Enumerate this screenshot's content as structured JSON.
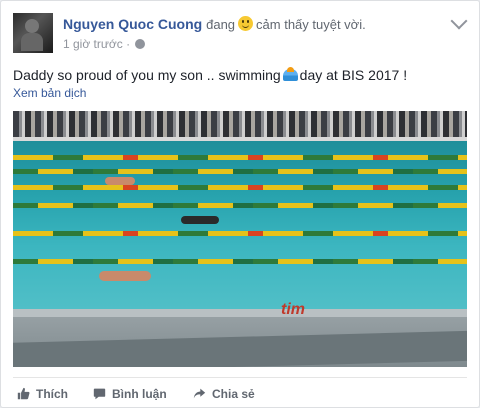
{
  "post": {
    "author": "Nguyen Quoc Cuong",
    "feeling_prefix": "đang",
    "feeling_text": "cảm thấy tuyệt vời.",
    "timestamp": "1 giờ trước",
    "dot": "·",
    "text_part1": "Daddy so proud of you my son .. swimming",
    "text_part2": "day at BIS 2017 !",
    "translate_link": "Xem bản dịch"
  },
  "photo": {
    "logo_text": "tim"
  },
  "actions": {
    "like": "Thích",
    "comment": "Bình luận",
    "share": "Chia sẻ"
  },
  "colors": {
    "name": "#365899",
    "meta": "#90949c",
    "action": "#616770"
  },
  "icons": [
    "profile-avatar",
    "smile-emoji-icon",
    "globe-icon",
    "chevron-down-icon",
    "swimmer-emoji-icon",
    "like-icon",
    "comment-icon",
    "share-icon"
  ]
}
